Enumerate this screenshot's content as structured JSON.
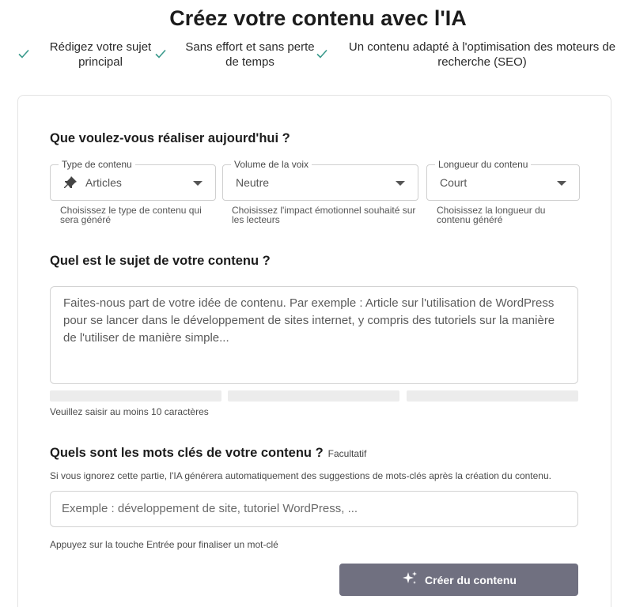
{
  "title": "Créez votre contenu avec l'IA",
  "benefits": [
    {
      "line1": "Rédigez votre sujet",
      "line2": "principal"
    },
    {
      "line1": "Sans effort et sans perte",
      "line2": "de temps"
    },
    {
      "line1": "Un contenu adapté à l'optimisation des moteurs de",
      "line2": "recherche (SEO)"
    }
  ],
  "colors": {
    "check": "#3a9a8c",
    "button": "#707080"
  },
  "section1": {
    "heading": "Que voulez-vous réaliser aujourd'hui ?",
    "content_type": {
      "legend": "Type de contenu",
      "value": "Articles",
      "helper": "Choisissez le type de contenu qui sera généré",
      "icon": "pin-icon"
    },
    "voice": {
      "legend": "Volume de la voix",
      "value": "Neutre",
      "helper": "Choisissez l'impact émotionnel souhaité sur les lecteurs"
    },
    "length": {
      "legend": "Longueur du contenu",
      "value": "Court",
      "helper": "Choisissez la longueur du contenu généré"
    }
  },
  "section2": {
    "heading": "Quel est le sujet de votre contenu ?",
    "placeholder": "Faites-nous part de votre idée de contenu. Par exemple : Article sur l'utilisation de WordPress pour se lancer dans le développement de sites internet, y compris des tutoriels sur la manière de l'utiliser de manière simple...",
    "min_note": "Veuillez saisir au moins 10 caractères"
  },
  "section3": {
    "heading": "Quels sont les mots clés de votre contenu ?",
    "optional": "Facultatif",
    "description": "Si vous ignorez cette partie, l'IA générera automatiquement des suggestions de mots-clés après la création du contenu.",
    "placeholder": "Exemple : développement de site, tutoriel WordPress, ...",
    "enter_note": "Appuyez sur la touche Entrée pour finaliser un mot-clé"
  },
  "button": {
    "label": "Créer du contenu",
    "icon": "sparkles-icon"
  }
}
